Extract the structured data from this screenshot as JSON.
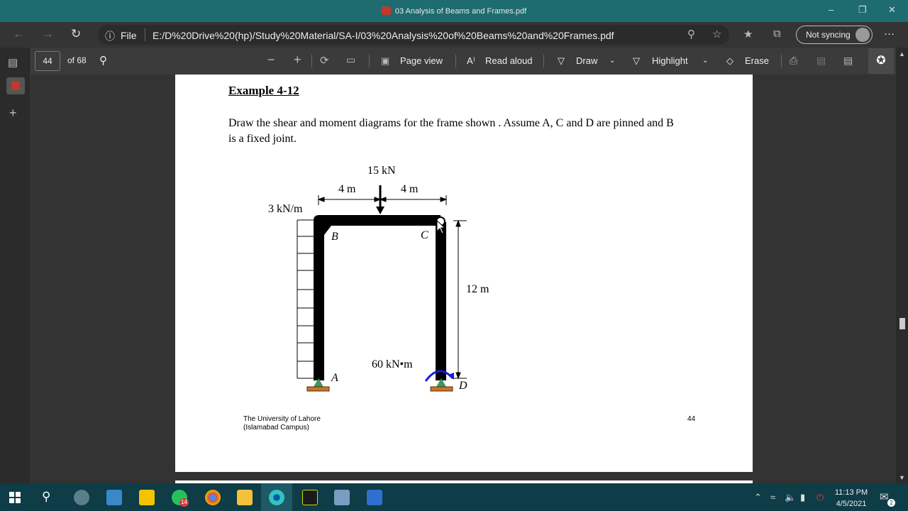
{
  "window": {
    "title": "03 Analysis of Beams and Frames.pdf"
  },
  "address_bar": {
    "file_label": "File",
    "url": "E:/D%20Drive%20(hp)/Study%20Material/SA-I/03%20Analysis%20of%20Beams%20and%20Frames.pdf",
    "sync_label": "Not syncing",
    "more_label": "···"
  },
  "pdf_toolbar": {
    "page_number": "44",
    "page_total": "of 68",
    "page_view": "Page view",
    "read_aloud": "Read aloud",
    "draw": "Draw",
    "highlight": "Highlight",
    "erase": "Erase"
  },
  "document": {
    "heading": "Example 4-12",
    "paragraph": "Draw the shear and moment diagrams for the frame shown . Assume A, C and D are pinned and B is a fixed joint.",
    "figure": {
      "load_point": "15 kN",
      "dim_left": "4 m",
      "dim_right": "4 m",
      "dist_load": "3 kN/m",
      "height": "12 m",
      "moment": "60 kN•m",
      "label_a": "A",
      "label_b": "B",
      "label_c": "C",
      "label_d": "D"
    },
    "footer_line1": "The University of Lahore",
    "footer_line2": "(Islamabad Campus)",
    "footer_page": "44"
  },
  "taskbar": {
    "whatsapp_badge": "14",
    "time": "11:13 PM",
    "date": "4/5/2021",
    "notification_count": "2"
  },
  "colors": {
    "titlebar": "#1e6b70",
    "taskbar": "#0e3c47",
    "support_green": "#3a9a5a",
    "support_base": "#c8742a",
    "moment_arrow": "#1a1adf"
  }
}
